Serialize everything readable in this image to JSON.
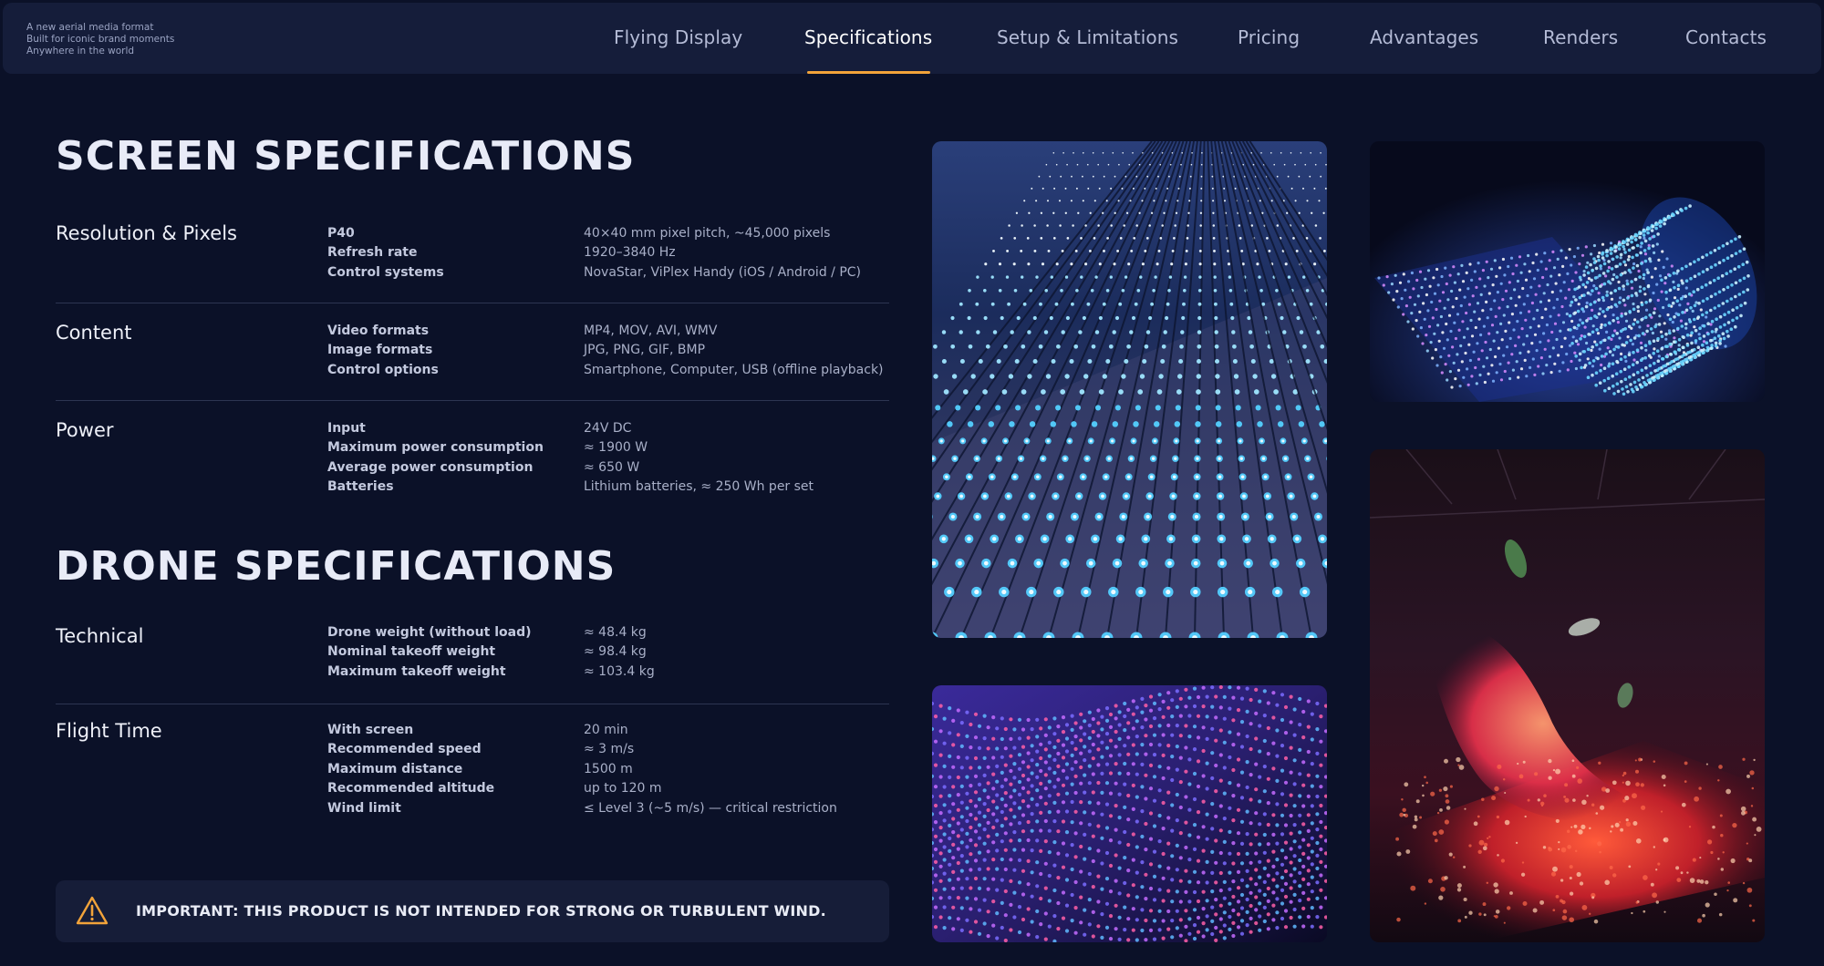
{
  "header": {
    "tagline": [
      "A new aerial media format",
      "Built for iconic brand moments",
      "Anywhere in the world"
    ],
    "nav": [
      {
        "label": "Flying Display",
        "active": false
      },
      {
        "label": "Specifications",
        "active": true
      },
      {
        "label": "Setup & Limitations",
        "active": false
      },
      {
        "label": "Pricing",
        "active": false
      },
      {
        "label": "Advantages",
        "active": false
      },
      {
        "label": "Renders",
        "active": false
      },
      {
        "label": "Contacts",
        "active": false
      }
    ],
    "accent_color": "#f2a33a"
  },
  "screen_specs": {
    "title": "SCREEN SPECIFICATIONS",
    "groups": [
      {
        "label": "Resolution & Pixels",
        "rows": [
          {
            "key": "P40",
            "value": "40×40 mm pixel pitch, ~45,000 pixels"
          },
          {
            "key": "Refresh rate",
            "value": "1920–3840 Hz"
          },
          {
            "key": "Control systems",
            "value": "NovaStar, ViPlex Handy (iOS / Android / PC)"
          }
        ]
      },
      {
        "label": "Content",
        "rows": [
          {
            "key": "Video formats",
            "value": "MP4, MOV, AVI, WMV"
          },
          {
            "key": "Image formats",
            "value": "JPG, PNG, GIF, BMP"
          },
          {
            "key": "Control options",
            "value": "Smartphone, Computer, USB (offline playback)"
          }
        ]
      },
      {
        "label": "Power",
        "rows": [
          {
            "key": "Input",
            "value": "24V DC"
          },
          {
            "key": "Maximum power consumption",
            "value": "≈ 1900 W"
          },
          {
            "key": "Average power consumption",
            "value": "≈ 650 W"
          },
          {
            "key": "Batteries",
            "value": "Lithium batteries, ≈ 250 Wh per set"
          }
        ]
      }
    ]
  },
  "drone_specs": {
    "title": "DRONE SPECIFICATIONS",
    "groups": [
      {
        "label": "Technical",
        "rows": [
          {
            "key": "Drone weight (without load)",
            "value": "≈ 48.4 kg"
          },
          {
            "key": "Nominal takeoff weight",
            "value": "≈ 98.4 kg"
          },
          {
            "key": "Maximum takeoff weight",
            "value": "≈ 103.4 kg"
          }
        ]
      },
      {
        "label": "Flight Time",
        "rows": [
          {
            "key": "With screen",
            "value": "20 min"
          },
          {
            "key": "Recommended speed",
            "value": "≈ 3 m/s"
          },
          {
            "key": "Maximum distance",
            "value": "1500 m"
          },
          {
            "key": "Recommended altitude",
            "value": "up to 120 m"
          },
          {
            "key": "Wind limit",
            "value": "≤ Level 3 (~5 m/s) — critical restriction"
          }
        ]
      }
    ]
  },
  "warning": {
    "icon": "warning-triangle-icon",
    "text": "IMPORTANT: THIS PRODUCT IS NOT INTENDED FOR STRONG OR TURBULENT WIND."
  },
  "gallery": [
    {
      "icon": "led-grid-perspective-photo"
    },
    {
      "icon": "rolled-led-screen-photo"
    },
    {
      "icon": "wavy-led-mesh-photo"
    },
    {
      "icon": "led-floor-projection-photo"
    }
  ]
}
